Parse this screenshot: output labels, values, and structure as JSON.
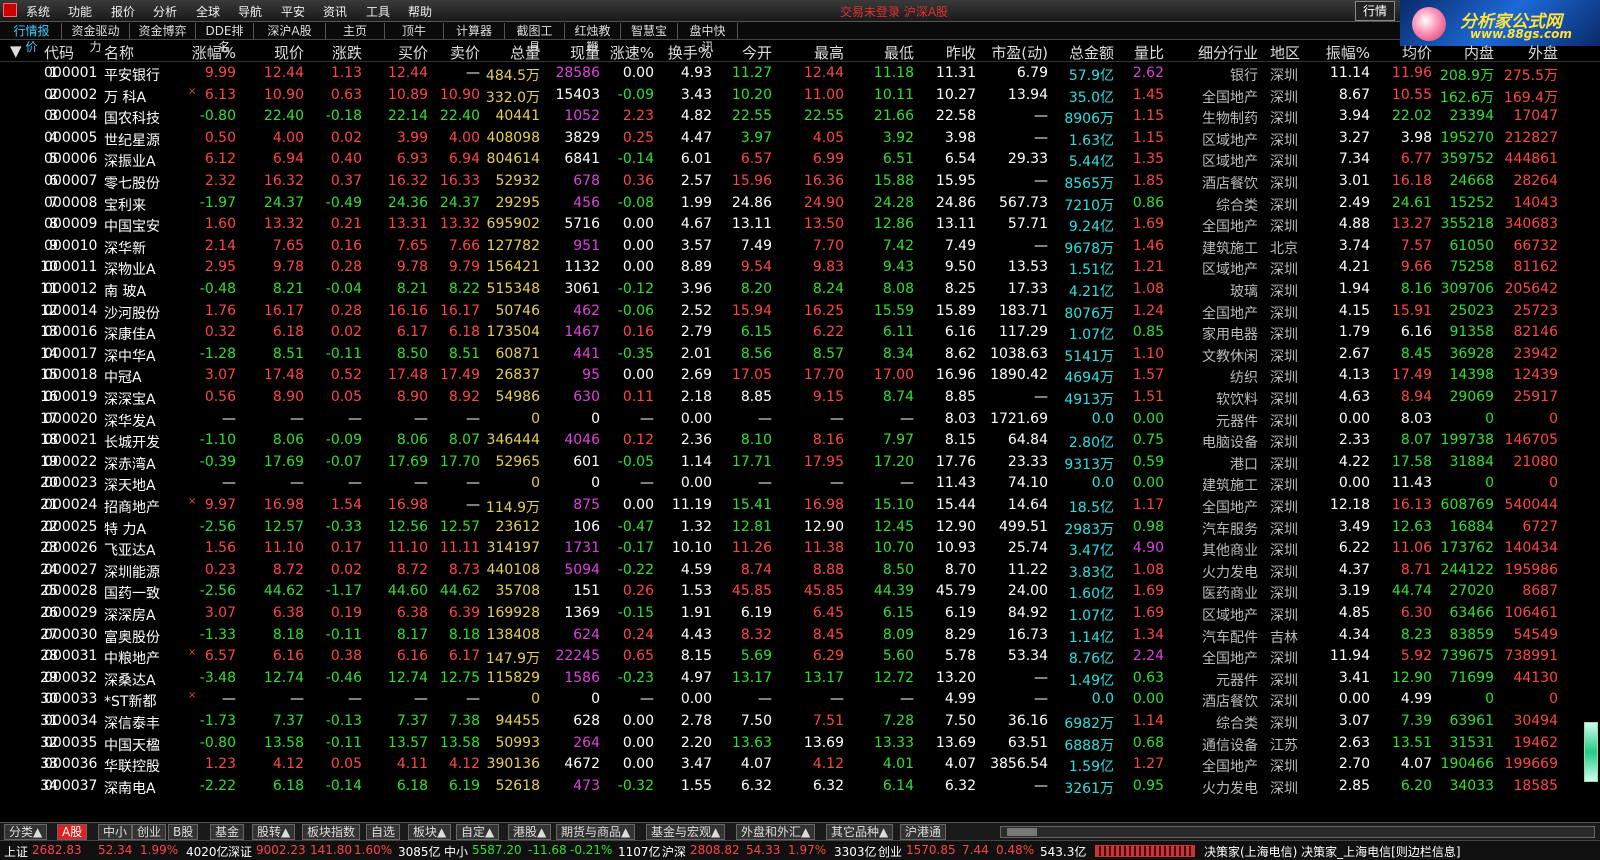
{
  "menu": {
    "items": [
      "系统",
      "功能",
      "报价",
      "分析",
      "全球",
      "导航",
      "平安",
      "资讯",
      "工具",
      "帮助"
    ],
    "notice": "交易未登录   沪深A股",
    "quote_button": "行情"
  },
  "logo": {
    "title": "分析家公式网",
    "url": "www.88gs.com"
  },
  "toolbar": [
    "行情报价",
    "资金驱动力",
    "资金博弈",
    "DDE排名",
    "深沪A股",
    "主页",
    "顶牛",
    "计算器",
    "截图工具",
    "红烛教鞭",
    "智慧宝",
    "盘中快讯"
  ],
  "columns": [
    "代码",
    "名称",
    "涨幅%",
    "现价",
    "涨跌",
    "买价",
    "卖价",
    "总量",
    "现量",
    "涨速%",
    "换手%",
    "今开",
    "最高",
    "最低",
    "昨收",
    "市盈(动)",
    "总金额",
    "量比",
    "细分行业",
    "地区",
    "振幅%",
    "均价",
    "内盘",
    "外盘"
  ],
  "rows": [
    [
      "1",
      "000001",
      "平安银行",
      "",
      "9.99",
      "12.44",
      "1.13",
      "12.44",
      "—",
      "484.5万",
      "28586",
      "0.00",
      "4.93",
      "11.27",
      "12.44",
      "11.18",
      "11.31",
      "6.79",
      "57.9亿",
      "2.62",
      "银行",
      "深圳",
      "11.14",
      "11.96",
      "208.9万",
      "275.5万"
    ],
    [
      "2",
      "000002",
      "万  科A",
      "×",
      "6.13",
      "10.90",
      "0.63",
      "10.89",
      "10.90",
      "332.0万",
      "15403",
      "-0.09",
      "3.43",
      "10.20",
      "11.00",
      "10.11",
      "10.27",
      "13.94",
      "35.0亿",
      "1.45",
      "全国地产",
      "深圳",
      "8.67",
      "10.55",
      "162.6万",
      "169.4万"
    ],
    [
      "3",
      "000004",
      "国农科技",
      "",
      "-0.80",
      "22.40",
      "-0.18",
      "22.14",
      "22.40",
      "40441",
      "1052",
      "2.23",
      "4.82",
      "22.55",
      "22.55",
      "21.66",
      "22.58",
      "—",
      "8906万",
      "1.15",
      "生物制药",
      "深圳",
      "3.94",
      "22.02",
      "23394",
      "17047"
    ],
    [
      "4",
      "000005",
      "世纪星源",
      "",
      "0.50",
      "4.00",
      "0.02",
      "3.99",
      "4.00",
      "408098",
      "3829",
      "0.25",
      "4.47",
      "3.97",
      "4.05",
      "3.92",
      "3.98",
      "—",
      "1.63亿",
      "1.15",
      "区域地产",
      "深圳",
      "3.27",
      "3.98",
      "195270",
      "212827"
    ],
    [
      "5",
      "000006",
      "深振业A",
      "",
      "6.12",
      "6.94",
      "0.40",
      "6.93",
      "6.94",
      "804614",
      "6841",
      "-0.14",
      "6.01",
      "6.57",
      "6.99",
      "6.51",
      "6.54",
      "29.33",
      "5.44亿",
      "1.35",
      "区域地产",
      "深圳",
      "7.34",
      "6.77",
      "359752",
      "444861"
    ],
    [
      "6",
      "000007",
      "零七股份",
      "",
      "2.32",
      "16.32",
      "0.37",
      "16.32",
      "16.33",
      "52932",
      "678",
      "0.36",
      "2.57",
      "15.96",
      "16.36",
      "15.88",
      "15.95",
      "—",
      "8565万",
      "1.85",
      "酒店餐饮",
      "深圳",
      "3.01",
      "16.18",
      "24668",
      "28264"
    ],
    [
      "7",
      "000008",
      "宝利来",
      "",
      "-1.97",
      "24.37",
      "-0.49",
      "24.36",
      "24.37",
      "29295",
      "456",
      "-0.08",
      "1.99",
      "24.86",
      "24.90",
      "24.28",
      "24.86",
      "567.73",
      "7210万",
      "0.86",
      "综合类",
      "深圳",
      "2.49",
      "24.61",
      "15252",
      "14043"
    ],
    [
      "8",
      "000009",
      "中国宝安",
      "",
      "1.60",
      "13.32",
      "0.21",
      "13.31",
      "13.32",
      "695902",
      "5716",
      "0.00",
      "4.67",
      "13.11",
      "13.50",
      "12.86",
      "13.11",
      "57.71",
      "9.24亿",
      "1.69",
      "全国地产",
      "深圳",
      "4.88",
      "13.27",
      "355218",
      "340683"
    ],
    [
      "9",
      "000010",
      "深华新",
      "",
      "2.14",
      "7.65",
      "0.16",
      "7.65",
      "7.66",
      "127782",
      "951",
      "0.00",
      "3.57",
      "7.49",
      "7.70",
      "7.42",
      "7.49",
      "—",
      "9678万",
      "1.46",
      "建筑施工",
      "北京",
      "3.74",
      "7.57",
      "61050",
      "66732"
    ],
    [
      "10",
      "000011",
      "深物业A",
      "",
      "2.95",
      "9.78",
      "0.28",
      "9.78",
      "9.79",
      "156421",
      "1132",
      "0.00",
      "8.89",
      "9.54",
      "9.83",
      "9.43",
      "9.50",
      "13.53",
      "1.51亿",
      "1.21",
      "区域地产",
      "深圳",
      "4.21",
      "9.66",
      "75258",
      "81162"
    ],
    [
      "11",
      "000012",
      "南  玻A",
      "",
      "-0.48",
      "8.21",
      "-0.04",
      "8.21",
      "8.22",
      "515348",
      "3061",
      "-0.12",
      "3.96",
      "8.20",
      "8.24",
      "8.08",
      "8.25",
      "17.33",
      "4.21亿",
      "1.08",
      "玻璃",
      "深圳",
      "1.94",
      "8.16",
      "309706",
      "205642"
    ],
    [
      "12",
      "000014",
      "沙河股份",
      "",
      "1.76",
      "16.17",
      "0.28",
      "16.16",
      "16.17",
      "50746",
      "462",
      "-0.06",
      "2.52",
      "15.94",
      "16.25",
      "15.59",
      "15.89",
      "183.71",
      "8076万",
      "1.24",
      "全国地产",
      "深圳",
      "4.15",
      "15.91",
      "25023",
      "25723"
    ],
    [
      "13",
      "000016",
      "深康佳A",
      "",
      "0.32",
      "6.18",
      "0.02",
      "6.17",
      "6.18",
      "173504",
      "1467",
      "0.16",
      "2.79",
      "6.15",
      "6.22",
      "6.11",
      "6.16",
      "117.29",
      "1.07亿",
      "0.85",
      "家用电器",
      "深圳",
      "1.79",
      "6.16",
      "91358",
      "82146"
    ],
    [
      "14",
      "000017",
      "深中华A",
      "",
      "-1.28",
      "8.51",
      "-0.11",
      "8.50",
      "8.51",
      "60871",
      "441",
      "-0.35",
      "2.01",
      "8.56",
      "8.57",
      "8.34",
      "8.62",
      "1038.63",
      "5141万",
      "1.10",
      "文教休闲",
      "深圳",
      "2.67",
      "8.45",
      "36928",
      "23942"
    ],
    [
      "15",
      "000018",
      "中冠A",
      "",
      "3.07",
      "17.48",
      "0.52",
      "17.48",
      "17.49",
      "26837",
      "95",
      "0.00",
      "2.69",
      "17.05",
      "17.70",
      "17.00",
      "16.96",
      "1890.42",
      "4694万",
      "1.57",
      "纺织",
      "深圳",
      "4.13",
      "17.49",
      "14398",
      "12439"
    ],
    [
      "16",
      "000019",
      "深深宝A",
      "",
      "0.56",
      "8.90",
      "0.05",
      "8.90",
      "8.92",
      "54986",
      "630",
      "0.11",
      "2.18",
      "8.85",
      "9.15",
      "8.74",
      "8.85",
      "—",
      "4913万",
      "1.51",
      "软饮料",
      "深圳",
      "4.63",
      "8.94",
      "29069",
      "25917"
    ],
    [
      "17",
      "000020",
      "深华发A",
      "",
      "—",
      "—",
      "—",
      "—",
      "—",
      "0",
      "0",
      "—",
      "0.00",
      "—",
      "—",
      "—",
      "8.03",
      "1721.69",
      "0.0",
      "0.00",
      "元器件",
      "深圳",
      "0.00",
      "8.03",
      "0",
      "0"
    ],
    [
      "18",
      "000021",
      "长城开发",
      "",
      "-1.10",
      "8.06",
      "-0.09",
      "8.06",
      "8.07",
      "346444",
      "4046",
      "0.12",
      "2.36",
      "8.10",
      "8.16",
      "7.97",
      "8.15",
      "64.84",
      "2.80亿",
      "0.75",
      "电脑设备",
      "深圳",
      "2.33",
      "8.07",
      "199738",
      "146705"
    ],
    [
      "19",
      "000022",
      "深赤湾A",
      "",
      "-0.39",
      "17.69",
      "-0.07",
      "17.69",
      "17.70",
      "52965",
      "601",
      "-0.05",
      "1.14",
      "17.71",
      "17.95",
      "17.20",
      "17.76",
      "23.33",
      "9313万",
      "0.59",
      "港口",
      "深圳",
      "4.22",
      "17.58",
      "31884",
      "21080"
    ],
    [
      "20",
      "000023",
      "深天地A",
      "",
      "—",
      "—",
      "—",
      "—",
      "—",
      "0",
      "0",
      "—",
      "0.00",
      "—",
      "—",
      "—",
      "11.43",
      "74.10",
      "0.0",
      "0.00",
      "建筑施工",
      "深圳",
      "0.00",
      "11.43",
      "0",
      "0"
    ],
    [
      "21",
      "000024",
      "招商地产",
      "×",
      "9.97",
      "16.98",
      "1.54",
      "16.98",
      "—",
      "114.9万",
      "875",
      "0.00",
      "11.19",
      "15.41",
      "16.98",
      "15.10",
      "15.44",
      "14.64",
      "18.5亿",
      "1.17",
      "全国地产",
      "深圳",
      "12.18",
      "16.13",
      "608769",
      "540044"
    ],
    [
      "22",
      "000025",
      "特  力A",
      "",
      "-2.56",
      "12.57",
      "-0.33",
      "12.56",
      "12.57",
      "23612",
      "106",
      "-0.47",
      "1.32",
      "12.81",
      "12.90",
      "12.45",
      "12.90",
      "499.51",
      "2983万",
      "0.98",
      "汽车服务",
      "深圳",
      "3.49",
      "12.63",
      "16884",
      "6727"
    ],
    [
      "23",
      "000026",
      "飞亚达A",
      "",
      "1.56",
      "11.10",
      "0.17",
      "11.10",
      "11.11",
      "314197",
      "1731",
      "-0.17",
      "10.10",
      "11.26",
      "11.38",
      "10.70",
      "10.93",
      "25.74",
      "3.47亿",
      "4.90",
      "其他商业",
      "深圳",
      "6.22",
      "11.06",
      "173762",
      "140434"
    ],
    [
      "24",
      "000027",
      "深圳能源",
      "",
      "0.23",
      "8.72",
      "0.02",
      "8.72",
      "8.73",
      "440108",
      "5094",
      "-0.22",
      "4.59",
      "8.74",
      "8.88",
      "8.50",
      "8.70",
      "11.22",
      "3.83亿",
      "1.08",
      "火力发电",
      "深圳",
      "4.37",
      "8.71",
      "244122",
      "195986"
    ],
    [
      "25",
      "000028",
      "国药一致",
      "",
      "-2.56",
      "44.62",
      "-1.17",
      "44.60",
      "44.62",
      "35708",
      "151",
      "0.26",
      "1.53",
      "45.85",
      "45.85",
      "44.39",
      "45.79",
      "24.00",
      "1.60亿",
      "1.69",
      "医药商业",
      "深圳",
      "3.19",
      "44.74",
      "27020",
      "8687"
    ],
    [
      "26",
      "000029",
      "深深房A",
      "",
      "3.07",
      "6.38",
      "0.19",
      "6.38",
      "6.39",
      "169928",
      "1369",
      "-0.15",
      "1.91",
      "6.19",
      "6.45",
      "6.15",
      "6.19",
      "84.92",
      "1.07亿",
      "1.69",
      "区域地产",
      "深圳",
      "4.85",
      "6.30",
      "63466",
      "106461"
    ],
    [
      "27",
      "000030",
      "富奥股份",
      "",
      "-1.33",
      "8.18",
      "-0.11",
      "8.17",
      "8.18",
      "138408",
      "624",
      "0.24",
      "4.43",
      "8.32",
      "8.45",
      "8.09",
      "8.29",
      "16.73",
      "1.14亿",
      "1.34",
      "汽车配件",
      "吉林",
      "4.34",
      "8.23",
      "83859",
      "54549"
    ],
    [
      "28",
      "000031",
      "中粮地产",
      "×",
      "6.57",
      "6.16",
      "0.38",
      "6.16",
      "6.17",
      "147.9万",
      "22245",
      "0.65",
      "8.15",
      "5.69",
      "6.29",
      "5.60",
      "5.78",
      "53.34",
      "8.76亿",
      "2.24",
      "全国地产",
      "深圳",
      "11.94",
      "5.92",
      "739675",
      "738991"
    ],
    [
      "29",
      "000032",
      "深桑达A",
      "",
      "-3.48",
      "12.74",
      "-0.46",
      "12.74",
      "12.75",
      "115829",
      "1586",
      "-0.23",
      "4.97",
      "13.17",
      "13.17",
      "12.72",
      "13.20",
      "—",
      "1.49亿",
      "0.63",
      "元器件",
      "深圳",
      "3.41",
      "12.90",
      "71699",
      "44130"
    ],
    [
      "30",
      "000033",
      "*ST新都",
      "×",
      "—",
      "—",
      "—",
      "—",
      "—",
      "0",
      "0",
      "—",
      "0.00",
      "—",
      "—",
      "—",
      "4.99",
      "—",
      "0.0",
      "0.00",
      "酒店餐饮",
      "深圳",
      "0.00",
      "4.99",
      "0",
      "0"
    ],
    [
      "31",
      "000034",
      "深信泰丰",
      "",
      "-1.73",
      "7.37",
      "-0.13",
      "7.37",
      "7.38",
      "94455",
      "628",
      "0.00",
      "2.78",
      "7.50",
      "7.51",
      "7.28",
      "7.50",
      "36.16",
      "6982万",
      "1.14",
      "综合类",
      "深圳",
      "3.07",
      "7.39",
      "63961",
      "30494"
    ],
    [
      "32",
      "000035",
      "中国天楹",
      "",
      "-0.80",
      "13.58",
      "-0.11",
      "13.57",
      "13.58",
      "50993",
      "264",
      "0.00",
      "2.20",
      "13.63",
      "13.69",
      "13.33",
      "13.69",
      "63.51",
      "6888万",
      "0.68",
      "通信设备",
      "江苏",
      "2.63",
      "13.51",
      "31531",
      "19462"
    ],
    [
      "33",
      "000036",
      "华联控股",
      "",
      "1.23",
      "4.12",
      "0.05",
      "4.11",
      "4.12",
      "390136",
      "4672",
      "0.00",
      "3.47",
      "4.07",
      "4.12",
      "4.01",
      "4.07",
      "3856.54",
      "1.59亿",
      "1.27",
      "全国地产",
      "深圳",
      "2.70",
      "4.07",
      "190466",
      "199669"
    ],
    [
      "34",
      "000037",
      "深南电A",
      "",
      "-2.22",
      "6.18",
      "-0.14",
      "6.18",
      "6.19",
      "52618",
      "473",
      "-0.32",
      "1.55",
      "6.32",
      "6.32",
      "6.14",
      "6.32",
      "—",
      "3261万",
      "0.95",
      "火力发电",
      "深圳",
      "2.85",
      "6.20",
      "34033",
      "18585"
    ]
  ],
  "bottom_tabs": [
    "分类▲",
    "A股",
    "中小",
    "创业",
    "B股",
    "基金",
    "股转▲",
    "板块指数",
    "自选",
    "板块▲",
    "自定▲",
    "港股▲",
    "期货与商品▲",
    "基金与宏观▲",
    "外盘和外汇▲",
    "其它品种▲",
    "沪港通"
  ],
  "active_tab": "A股",
  "status": {
    "sh_label": "上证",
    "sh_val": "2682.83",
    "sh_chg": "52.34",
    "sh_pct": "1.99%",
    "sh_amt": "4020亿",
    "sz_label": "深证",
    "sz_val": "9002.23",
    "sz_chg": "141.80",
    "sz_pct": "1.60%",
    "sz_amt": "3085亿",
    "zx_label": "中小",
    "zx_val": "5587.20",
    "zx_chg": "-11.68",
    "zx_pct": "-0.21%",
    "zx_amt": "1107亿",
    "hs_label": "沪深",
    "hs_val": "2808.82",
    "hs_chg": "54.33",
    "hs_pct": "1.97%",
    "hs_amt": "3303亿",
    "cy_label": "创业",
    "cy_val": "1570.85",
    "cy_chg": "7.44",
    "cy_pct": "0.48%",
    "cy_amt": "543.3亿",
    "broker": "决策家(上海电信) 决策家_上海电信[则边栏信息]"
  }
}
